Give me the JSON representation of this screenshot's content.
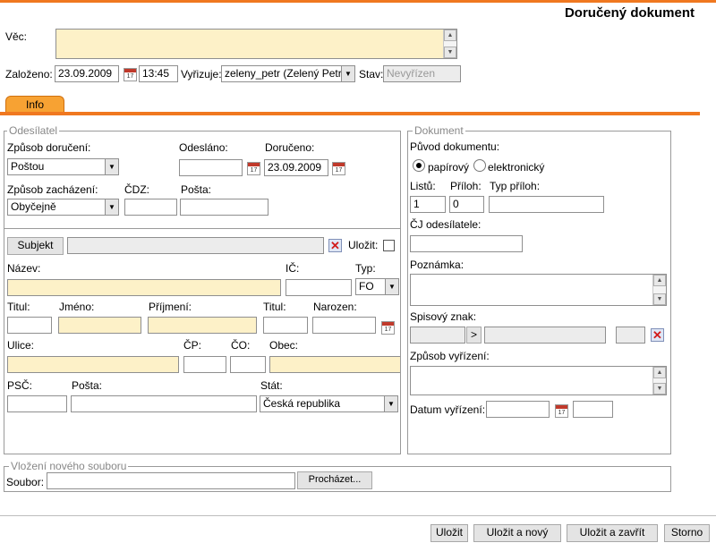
{
  "page_title": "Doručený dokument",
  "header": {
    "vec_label": "Věc:",
    "vec_value": "",
    "zalozeno_label": "Založeno:",
    "zalozeno_date": "23.09.2009",
    "zalozeno_time": "13:45",
    "vyrizuje_label": "Vyřizuje:",
    "vyrizuje_value": "zeleny_petr (Zelený Petr",
    "stav_label": "Stav:",
    "stav_value": "Nevyřízen"
  },
  "tabs": [
    {
      "label": "Info"
    }
  ],
  "calendar_icon_text": "17",
  "odesilatel": {
    "legend": "Odesílatel",
    "zpusob_doruceni_label": "Způsob doručení:",
    "zpusob_doruceni_value": "Poštou",
    "odeslano_label": "Odesláno:",
    "odeslano_value": "",
    "doruceno_label": "Doručeno:",
    "doruceno_value": "23.09.2009",
    "zpusob_zachazeni_label": "Způsob zacházení:",
    "zpusob_zachazeni_value": "Obyčejně",
    "cdz_label": "ČDZ:",
    "posta_label": "Pošta:"
  },
  "subjekt": {
    "button_label": "Subjekt",
    "field_value": "",
    "ulozit_label": "Uložit:",
    "ulozit_checked": false,
    "nazev_label": "Název:",
    "ic_label": "IČ:",
    "typ_label": "Typ:",
    "typ_value": "FO",
    "titul_label": "Titul:",
    "jmeno_label": "Jméno:",
    "prijmeni_label": "Příjmení:",
    "titul2_label": "Titul:",
    "narozen_label": "Narozen:",
    "ulice_label": "Ulice:",
    "cp_label": "ČP:",
    "co_label": "ČO:",
    "obec_label": "Obec:",
    "psc_label": "PSČ:",
    "posta_label": "Pošta:",
    "stat_label": "Stát:",
    "stat_value": "Česká republika"
  },
  "dokument": {
    "legend": "Dokument",
    "puvod_label": "Původ dokumentu:",
    "puvod_options": [
      "papírový",
      "elektronický"
    ],
    "puvod_selected": "papírový",
    "listu_label": "Listů:",
    "listu_value": "1",
    "priloh_label": "Příloh:",
    "priloh_value": "0",
    "typ_priloh_label": "Typ příloh:",
    "cj_label": "ČJ odesílatele:",
    "poznamka_label": "Poznámka:",
    "spisovy_znak_label": "Spisový znak:",
    "spisovy_arrow": ">",
    "zpusob_vyrizeni_label": "Způsob vyřízení:",
    "datum_vyrizeni_label": "Datum vyřízení:"
  },
  "soubor": {
    "legend": "Vložení nového souboru",
    "label": "Soubor:",
    "browse_label": "Procházet..."
  },
  "footer_buttons": {
    "ulozit": "Uložit",
    "ulozit_novy": "Uložit a nový",
    "ulozit_zavrit": "Uložit a zavřít",
    "storno": "Storno"
  },
  "colors": {
    "accent": "#f07820",
    "tab": "#f7a233",
    "required_field": "#fdf1c8"
  },
  "icons": [
    "calendar-icon",
    "delete-icon",
    "chevron-down-icon",
    "scroll-up-icon",
    "scroll-down-icon"
  ]
}
